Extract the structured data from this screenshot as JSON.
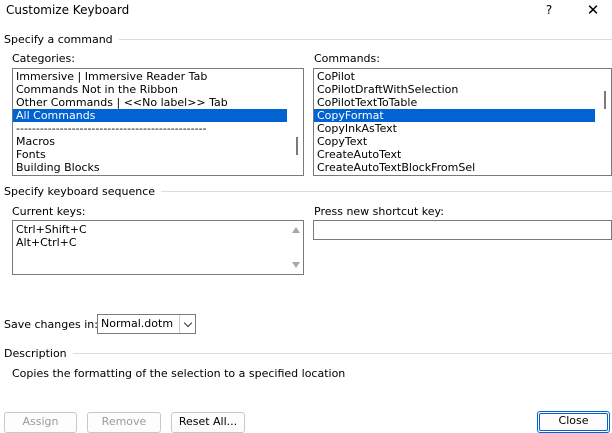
{
  "window": {
    "title": "Customize Keyboard",
    "help_glyph": "?",
    "close_glyph": "✕"
  },
  "specify_command": {
    "group_label": "Specify a command",
    "categories": {
      "label": "Categories:",
      "items": [
        "Immersive | Immersive Reader Tab",
        "Commands Not in the Ribbon",
        "Other Commands | <<No label>> Tab",
        "All Commands",
        "------------------------------------------------",
        "Macros",
        "Fonts",
        "Building Blocks"
      ],
      "selected_index": 3
    },
    "commands": {
      "label": "Commands:",
      "items": [
        "CoPilot",
        "CoPilotDraftWithSelection",
        "CoPilotTextToTable",
        "CopyFormat",
        "CopyInkAsText",
        "CopyText",
        "CreateAutoText",
        "CreateAutoTextBlockFromSel"
      ],
      "selected_index": 3
    }
  },
  "keyboard_sequence": {
    "group_label": "Specify keyboard sequence",
    "current_keys": {
      "label": "Current keys:",
      "items": [
        "Ctrl+Shift+C",
        "Alt+Ctrl+C"
      ]
    },
    "new_shortcut": {
      "label": "Press new shortcut key:",
      "value": ""
    }
  },
  "save_changes": {
    "label": "Save changes in:",
    "value": "Normal.dotm"
  },
  "description": {
    "group_label": "Description",
    "text": "Copies the formatting of the selection to a specified location"
  },
  "buttons": {
    "assign": "Assign",
    "remove": "Remove",
    "reset_all": "Reset All...",
    "close": "Close"
  },
  "colors": {
    "selection": "#0063d1",
    "border": "#7a7a7a",
    "accent": "#0063d1"
  }
}
